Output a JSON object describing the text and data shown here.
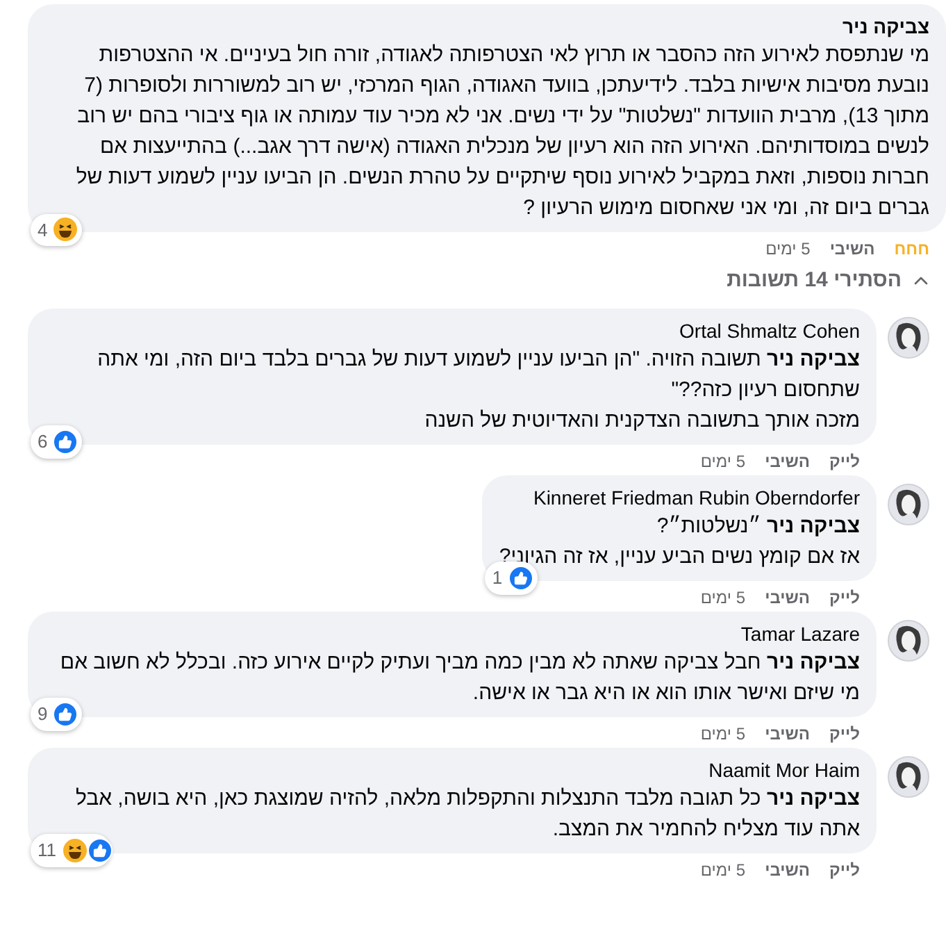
{
  "comments": [
    {
      "author": "צביקה ניר",
      "paragraphs": [
        "מי שנתפסת לאירוע הזה כהסבר או תרוץ לאי הצטרפותה לאגודה, זורה חול בעיניים. אי ההצטרפות נובעת מסיבות אישיות בלבד. לידיעתכן, בוועד האגודה, הגוף המרכזי, יש רוב למשוררות ולסופרות (7 מתוך 13), מרבית הוועדות \"נשלטות\" על ידי נשים. אני לא מכיר עוד עמותה או גוף ציבורי בהם יש רוב לנשים במוסדותיהם. האירוע הזה הוא רעיון של מנכלית האגודה (אישה דרך אגב...) בהתייעצות אם חברות נוספות, וזאת במקביל לאירוע נוסף שיתקיים על טהרת הנשים. הן הביעו עניין לשמוע דעות של גברים ביום זה, ומי אני שאחסום מימוש הרעיון ?"
      ],
      "reactions": [
        {
          "kind": "haha"
        }
      ],
      "reaction_count": "4",
      "react": {
        "label": "חחח",
        "selected": true
      },
      "reply": "השיבי",
      "time": "5 ימים"
    }
  ],
  "replies_toggle": {
    "label": "הסתירי 14 תשובות",
    "expanded": true
  },
  "replies": [
    {
      "author": "Ortal Shmaltz Cohen",
      "paragraphs": [
        "**צביקה ניר** תשובה הזויה. \"הן הביעו עניין לשמוע דעות של גברים בלבד ביום הזה, ומי אתה שתחסום רעיון כזה??\"",
        "מזכה אותך בתשובה הצדקנית והאדיוטית של השנה"
      ],
      "reactions": [
        {
          "kind": "like"
        }
      ],
      "reaction_count": "6",
      "react": {
        "label": "לייק",
        "selected": false
      },
      "reply": "השיבי",
      "time": "5 ימים"
    },
    {
      "author": "Kinneret Friedman Rubin Oberndorfer",
      "paragraphs": [
        "**צביקה ניר** ״נשלטות״?",
        "אז אם קומץ נשים הביע עניין, אז זה הגיוני?"
      ],
      "reactions": [
        {
          "kind": "like"
        }
      ],
      "reaction_count": "1",
      "react": {
        "label": "לייק",
        "selected": false
      },
      "reply": "השיבי",
      "time": "5 ימים"
    },
    {
      "author": "Tamar Lazare",
      "paragraphs": [
        "**צביקה ניר** חבל צביקה שאתה לא מבין כמה מביך ועתיק לקיים אירוע כזה. ובכלל לא חשוב אם מי שיזם ואישר אותו הוא או היא גבר או אישה."
      ],
      "reactions": [
        {
          "kind": "like"
        }
      ],
      "reaction_count": "9",
      "react": {
        "label": "לייק",
        "selected": false
      },
      "reply": "השיבי",
      "time": "5 ימים"
    },
    {
      "author": "Naamit Mor Haim",
      "paragraphs": [
        "**צביקה ניר** כל תגובה מלבד התנצלות והתקפלות מלאה, להזיה שמוצגת כאן, היא בושה, אבל אתה עוד מצליח להחמיר את המצב."
      ],
      "reactions": [
        {
          "kind": "like"
        },
        {
          "kind": "haha"
        }
      ],
      "reaction_count": "11",
      "react": {
        "label": "לייק",
        "selected": false
      },
      "reply": "השיבי",
      "time": "5 ימים"
    }
  ]
}
